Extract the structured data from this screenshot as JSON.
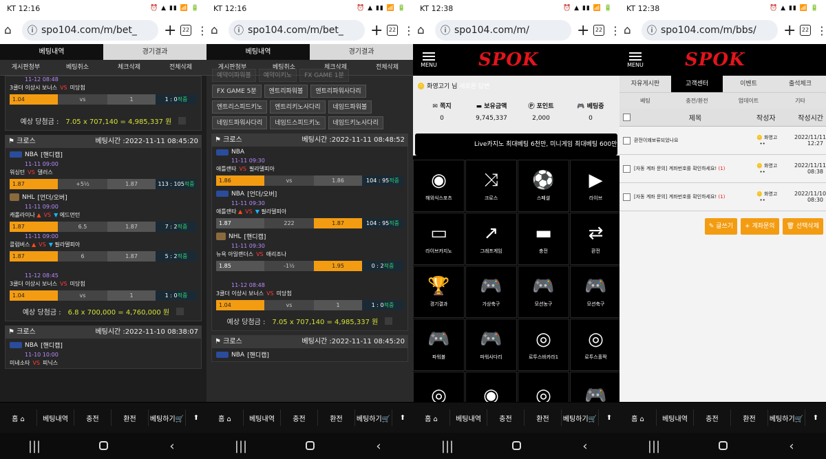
{
  "status": {
    "p1_time": "KT 12:16",
    "p2_time": "KT 12:16",
    "p3_time": "KT 12:38",
    "p4_time": "KT 12:38"
  },
  "url": {
    "p1": "spo104.com/m/bet_",
    "p2": "spo104.com/m/bet_",
    "p3": "spo104.com/m/",
    "p4": "spo104.com/m/bbs/",
    "tabs": "22"
  },
  "bet_tabs": [
    "베팅내역",
    "경기결과"
  ],
  "bet_sub": [
    "게시판청부",
    "베팅취소",
    "체크삭제",
    "전체삭제"
  ],
  "p1": {
    "top_time": "11-12 08:48",
    "top_teams": "3쿨더 이상시 보너스",
    "top_vs": "VS",
    "top_opp": "미당첨",
    "top_odds": [
      "1.04",
      "vs",
      "1",
      "1 : 0적중"
    ],
    "exp1_label": "예상 당첨금 :",
    "exp1_formula": "7.05 x 707,140 = 4,985,337 원",
    "card1_type": "크로스",
    "card1_time": "베팅시간 :2022-11-11 08:45:20",
    "l1": "NBA",
    "l1_tag": "[핸디캡]",
    "g1_time": "11-11 09:00",
    "g1_home": "워싱턴",
    "g1_vs": "VS",
    "g1_away": "댈러스",
    "g1_odds": [
      "1.87",
      "+5½",
      "1.87",
      "113 : 105적중"
    ],
    "l2": "NHL",
    "l2_tag": "[언더/오버]",
    "g2_time": "11-11 09:00",
    "g2_home": "캐롤라이나",
    "g2_vs": "VS",
    "g2_away": "에드먼턴",
    "g2_odds": [
      "1.87",
      "6.5",
      "1.87",
      "7 : 2적중"
    ],
    "g3_time": "11-11 09:00",
    "g3_home": "콜럼버스",
    "g3_vs": "VS",
    "g3_away": "필라델피아",
    "g3_odds": [
      "1.87",
      "6",
      "1.87",
      "5 : 2적중"
    ],
    "g4_time": "11-12 08:45",
    "g4_home": "3쿨더 이상시 보너스",
    "g4_vs": "VS",
    "g4_away": "미당첨",
    "g4_odds": [
      "1.04",
      "vs",
      "1",
      "1 : 0적중"
    ],
    "exp2_label": "예상 당첨금 :",
    "exp2_formula": "6.8 x 700,000 = 4,760,000 원",
    "card2_type": "크로스",
    "card2_time": "베팅시간 :2022-11-10 08:38:07",
    "l3": "NBA",
    "l3_tag": "[핸디캡]",
    "g5_time": "11-10 10:00",
    "g5_home": "미네소타",
    "g5_vs": "VS",
    "g5_away": "피닉스"
  },
  "p2": {
    "menu_rows": [
      [
        "예약이파워볼",
        "예약이키노",
        "FX GAME 1분"
      ],
      [
        "FX GAME 5분",
        "엔트리파워볼",
        "엔트리파워사다리"
      ],
      [
        "엔트리스피드키노",
        "엔트리키노사다리",
        "네임드파워볼"
      ],
      [
        "네임드파워사다리",
        "네임드스피드키노",
        "네임드키노사다리"
      ]
    ],
    "card1_type": "크로스",
    "card1_time": "베팅시간 :2022-11-11 08:48:52",
    "l1": "NBA",
    "g1_time": "11-11 09:30",
    "g1_home": "애틀랜타",
    "g1_vs": "VS",
    "g1_away": "필라델피아",
    "g1_odds": [
      "1.86",
      "vs",
      "1.86",
      "104 : 95적중"
    ],
    "l2": "NBA",
    "l2_tag": "[언더/오버]",
    "g2_time": "11-11 09:30",
    "g2_home": "애틀랜타",
    "g2_vs": "VS",
    "g2_away": "필라델피아",
    "g2_odds": [
      "1.87",
      "222",
      "1.87",
      "104 : 95적중"
    ],
    "l3": "NHL",
    "l3_tag": "[핸디캡]",
    "g3_time": "11-11 09:30",
    "g3_home": "뉴욕 아일랜더스",
    "g3_vs": "VS",
    "g3_away": "애리조나",
    "g3_odds": [
      "1.85",
      "-1½",
      "1.95",
      "0 : 2적중"
    ],
    "g4_time": "11-12 08:48",
    "g4_home": "3쿨더 이상시 보너스",
    "g4_vs": "VS",
    "g4_away": "미당첨",
    "g4_odds": [
      "1.04",
      "vs",
      "1",
      "1 : 0적중"
    ],
    "exp_label": "예상 당첨금 :",
    "exp_formula": "7.05 x 707,140 = 4,985,337 원",
    "card2_type": "크로스",
    "card2_time": "베팅시간 :2022-11-11 08:45:20",
    "l4": "NBA",
    "l4_tag": "[핸디캡]"
  },
  "p3": {
    "menu_label": "MENU",
    "logo": "SPOK",
    "greeting_name": "화영고기 님",
    "greeting_msg": "새로운 답변",
    "stats": [
      {
        "label": "쪽지",
        "value": "0"
      },
      {
        "label": "보유금액",
        "value": "9,745,337"
      },
      {
        "label": "포인트",
        "value": "2,000"
      },
      {
        "label": "베팅중",
        "value": "0"
      }
    ],
    "marquee": "Live카지노 최대베팅 6천만, 미니게임 최대베팅 600만원",
    "grid": [
      {
        "icon": "globe-icon",
        "glyph": "◉",
        "label": "해외식스포츠"
      },
      {
        "icon": "shuffle-icon",
        "glyph": "⤨",
        "label": "크로스"
      },
      {
        "icon": "soccer-ball-icon",
        "glyph": "⚽",
        "label": "스페셜"
      },
      {
        "icon": "play-icon",
        "glyph": "▶",
        "label": "라이브"
      },
      {
        "icon": "monitor-icon",
        "glyph": "▭",
        "label": "라이브카지노"
      },
      {
        "icon": "chart-up-icon",
        "glyph": "↗",
        "label": "그래프게임"
      },
      {
        "icon": "battery-icon",
        "glyph": "▬",
        "label": "충전"
      },
      {
        "icon": "exchange-icon",
        "glyph": "⇄",
        "label": "환전"
      },
      {
        "icon": "trophy-icon",
        "glyph": "🏆",
        "label": "경기결과"
      },
      {
        "icon": "gamepad-icon",
        "glyph": "🎮",
        "label": "가상축구"
      },
      {
        "icon": "gamepad-icon",
        "glyph": "🎮",
        "label": "모션농구"
      },
      {
        "icon": "gamepad-icon",
        "glyph": "🎮",
        "label": "모션축구"
      },
      {
        "icon": "gamepad-icon",
        "glyph": "🎮",
        "label": "파워볼"
      },
      {
        "icon": "gamepad-icon",
        "glyph": "🎮",
        "label": "파워사다리"
      },
      {
        "icon": "lifebuoy-icon",
        "glyph": "◎",
        "label": "로투스바카라1"
      },
      {
        "icon": "lifebuoy-icon",
        "glyph": "◎",
        "label": "로투스홀짝"
      },
      {
        "icon": "lifebuoy-icon",
        "glyph": "◎",
        "label": ""
      },
      {
        "icon": "target-icon",
        "glyph": "◉",
        "label": ""
      },
      {
        "icon": "lifebuoy-icon",
        "glyph": "◎",
        "label": ""
      },
      {
        "icon": "gamepad-icon",
        "glyph": "🎮",
        "label": ""
      }
    ]
  },
  "p4": {
    "menu_label": "MENU",
    "logo": "SPOK",
    "top_tabs": [
      "자유게시판",
      "고객센터",
      "이벤트",
      "출석체크"
    ],
    "sub_tabs": [
      "베팅",
      "충전/환전",
      "업데이트",
      "기타"
    ],
    "col_title": "제목",
    "col_author": "작성자",
    "col_date": "작성시간",
    "rows": [
      {
        "title": "환전이왜보류되었나요",
        "count": "",
        "author": "화영고",
        "date1": "2022/11/11",
        "date2": "12:27"
      },
      {
        "title": "[자동 계좌 문의] 계좌번호를 확인하세요!",
        "count": "(1)",
        "author": "화영고",
        "date1": "2022/11/11",
        "date2": "08:38"
      },
      {
        "title": "[자동 계좌 문의] 계좌번호를 확인하세요!",
        "count": "(1)",
        "author": "화영고",
        "date1": "2022/11/10",
        "date2": "08:30"
      }
    ],
    "btn_write": "글쓰기",
    "btn_account": "계좌문의",
    "btn_delete": "선택삭제"
  },
  "bottom_nav": [
    "홈",
    "베팅내역",
    "충전",
    "환전",
    "베팅하기"
  ],
  "colors": {
    "accent": "#f39c12",
    "win": "#2ed573",
    "brand": "#e3141b"
  }
}
